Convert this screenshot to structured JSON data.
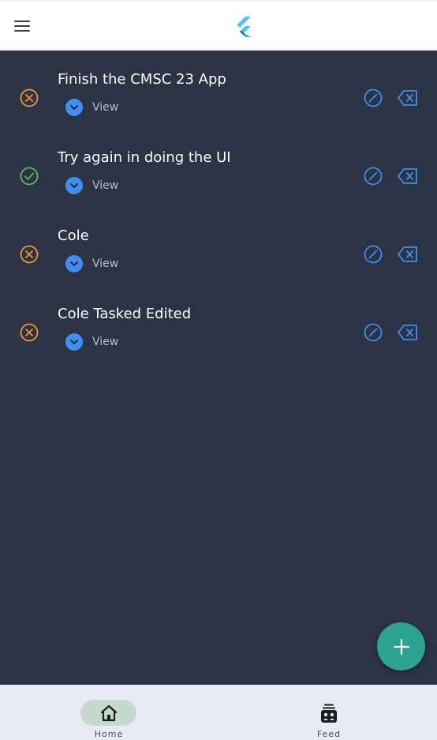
{
  "app": {
    "logo_icon": "flutter-logo",
    "menu_icon": "hamburger-menu-icon"
  },
  "colors": {
    "background": "#2b3344",
    "pending": "#f0962e",
    "done": "#5fb85f",
    "accent": "#3f8ef0",
    "fab": "#2ca38f"
  },
  "todos": [
    {
      "title": "Finish the CMSC 23 App",
      "completed": false,
      "view_label": "View"
    },
    {
      "title": "Try again in doing the UI",
      "completed": true,
      "view_label": "View"
    },
    {
      "title": "Cole",
      "completed": false,
      "view_label": "View"
    },
    {
      "title": "Cole Tasked Edited",
      "completed": false,
      "view_label": "View"
    }
  ],
  "fab": {
    "icon": "plus-icon"
  },
  "bottom_nav": {
    "items": [
      {
        "label": "Home",
        "icon": "home-icon",
        "selected": true
      },
      {
        "label": "Feed",
        "icon": "feed-icon",
        "selected": false
      }
    ]
  }
}
